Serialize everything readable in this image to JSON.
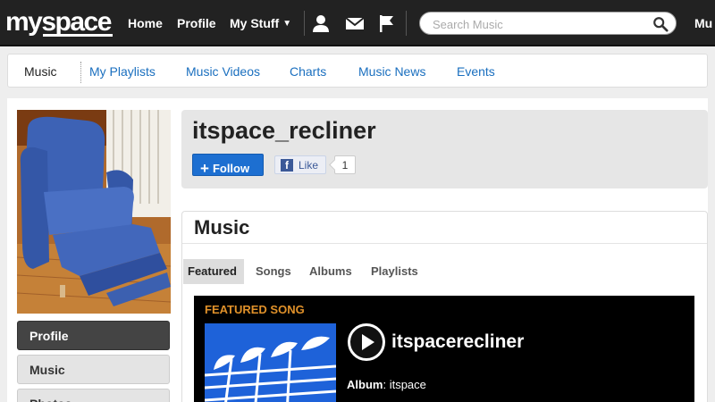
{
  "header": {
    "logo": "myspace",
    "nav": {
      "home": "Home",
      "profile": "Profile",
      "my_stuff": "My Stuff"
    },
    "search_placeholder": "Search Music",
    "right_label": "Mu"
  },
  "subnav": {
    "items": [
      "Music",
      "My Playlists",
      "Music Videos",
      "Charts",
      "Music News",
      "Events"
    ],
    "active": "Music"
  },
  "sidebar": {
    "items": [
      "Profile",
      "Music",
      "Photos"
    ],
    "active": "Profile"
  },
  "profile": {
    "name": "itspace_recliner",
    "follow_label": "Follow",
    "like_label": "Like",
    "like_count": "1"
  },
  "music": {
    "title": "Music",
    "tabs": [
      "Featured",
      "Songs",
      "Albums",
      "Playlists"
    ],
    "active_tab": "Featured",
    "featured": {
      "label": "FEATURED SONG",
      "song_title": "itspacerecliner",
      "album_key": "Album",
      "album_value": "itspace"
    }
  },
  "colors": {
    "topbar": "#222222",
    "link": "#1a6fbf",
    "follow_button": "#1d6fd1",
    "featured_label": "#e0912a",
    "album_art": "#1e62d9"
  },
  "icons": [
    "person-icon",
    "mail-icon",
    "flag-icon",
    "search-icon",
    "play-icon",
    "facebook-icon"
  ]
}
